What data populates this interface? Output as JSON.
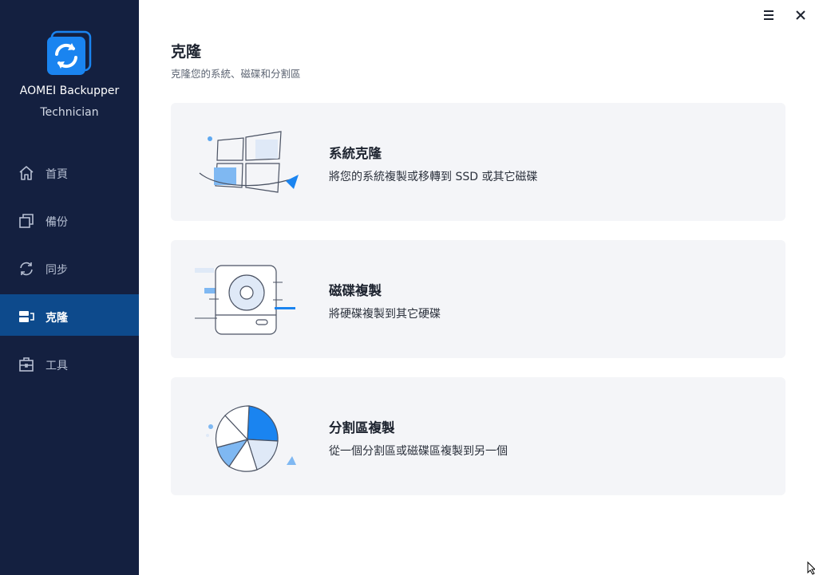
{
  "app": {
    "name": "AOMEI Backupper",
    "edition": "Technician"
  },
  "sidebar": {
    "items": [
      {
        "label": "首頁",
        "icon": "home-icon",
        "active": false
      },
      {
        "label": "備份",
        "icon": "backup-icon",
        "active": false
      },
      {
        "label": "同步",
        "icon": "sync-icon",
        "active": false
      },
      {
        "label": "克隆",
        "icon": "clone-icon",
        "active": true
      },
      {
        "label": "工具",
        "icon": "tools-icon",
        "active": false
      }
    ]
  },
  "window": {
    "menu_icon": "menu-icon",
    "close_icon": "close-icon"
  },
  "main": {
    "title": "克隆",
    "subtitle": "克隆您的系統、磁碟和分割區",
    "cards": [
      {
        "title": "系統克隆",
        "desc": "將您的系統複製或移轉到 SSD 或其它磁碟",
        "icon": "system-clone-illustration"
      },
      {
        "title": "磁碟複製",
        "desc": "將硬碟複製到其它硬碟",
        "icon": "disk-clone-illustration"
      },
      {
        "title": "分割區複製",
        "desc": "從一個分割區或磁碟區複製到另一個",
        "icon": "partition-clone-illustration"
      }
    ]
  },
  "colors": {
    "sidebar_bg": "#142040",
    "active_bg": "#0d4a8c",
    "accent": "#1a84f0",
    "card_bg": "#f4f5f8"
  }
}
